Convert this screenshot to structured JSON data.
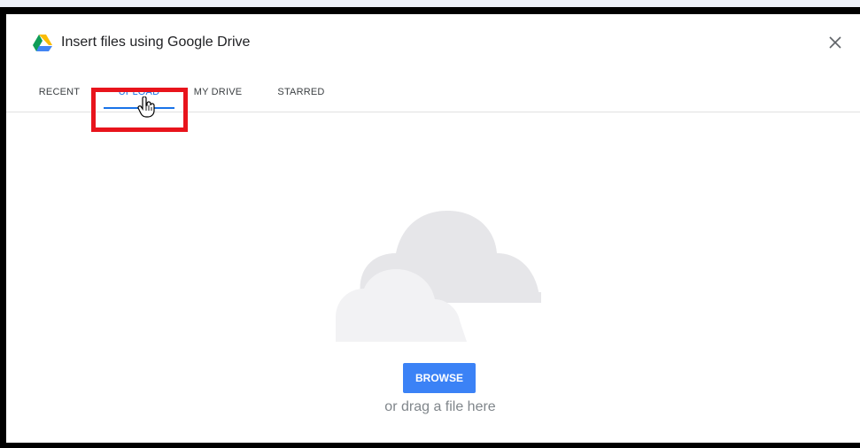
{
  "dialog": {
    "title": "Insert files using Google Drive",
    "close_icon": "close-icon",
    "logo_icon": "google-drive-icon"
  },
  "tabs": [
    {
      "label": "RECENT",
      "active": false
    },
    {
      "label": "UPLOAD",
      "active": true
    },
    {
      "label": "MY DRIVE",
      "active": false
    },
    {
      "label": "STARRED",
      "active": false
    }
  ],
  "upload": {
    "illustration": "cloud-icon",
    "browse_label": "BROWSE",
    "drag_text": "or drag a file here"
  },
  "colors": {
    "accent": "#1a73e8",
    "button": "#3b82f6",
    "highlight": "#e8141c"
  }
}
